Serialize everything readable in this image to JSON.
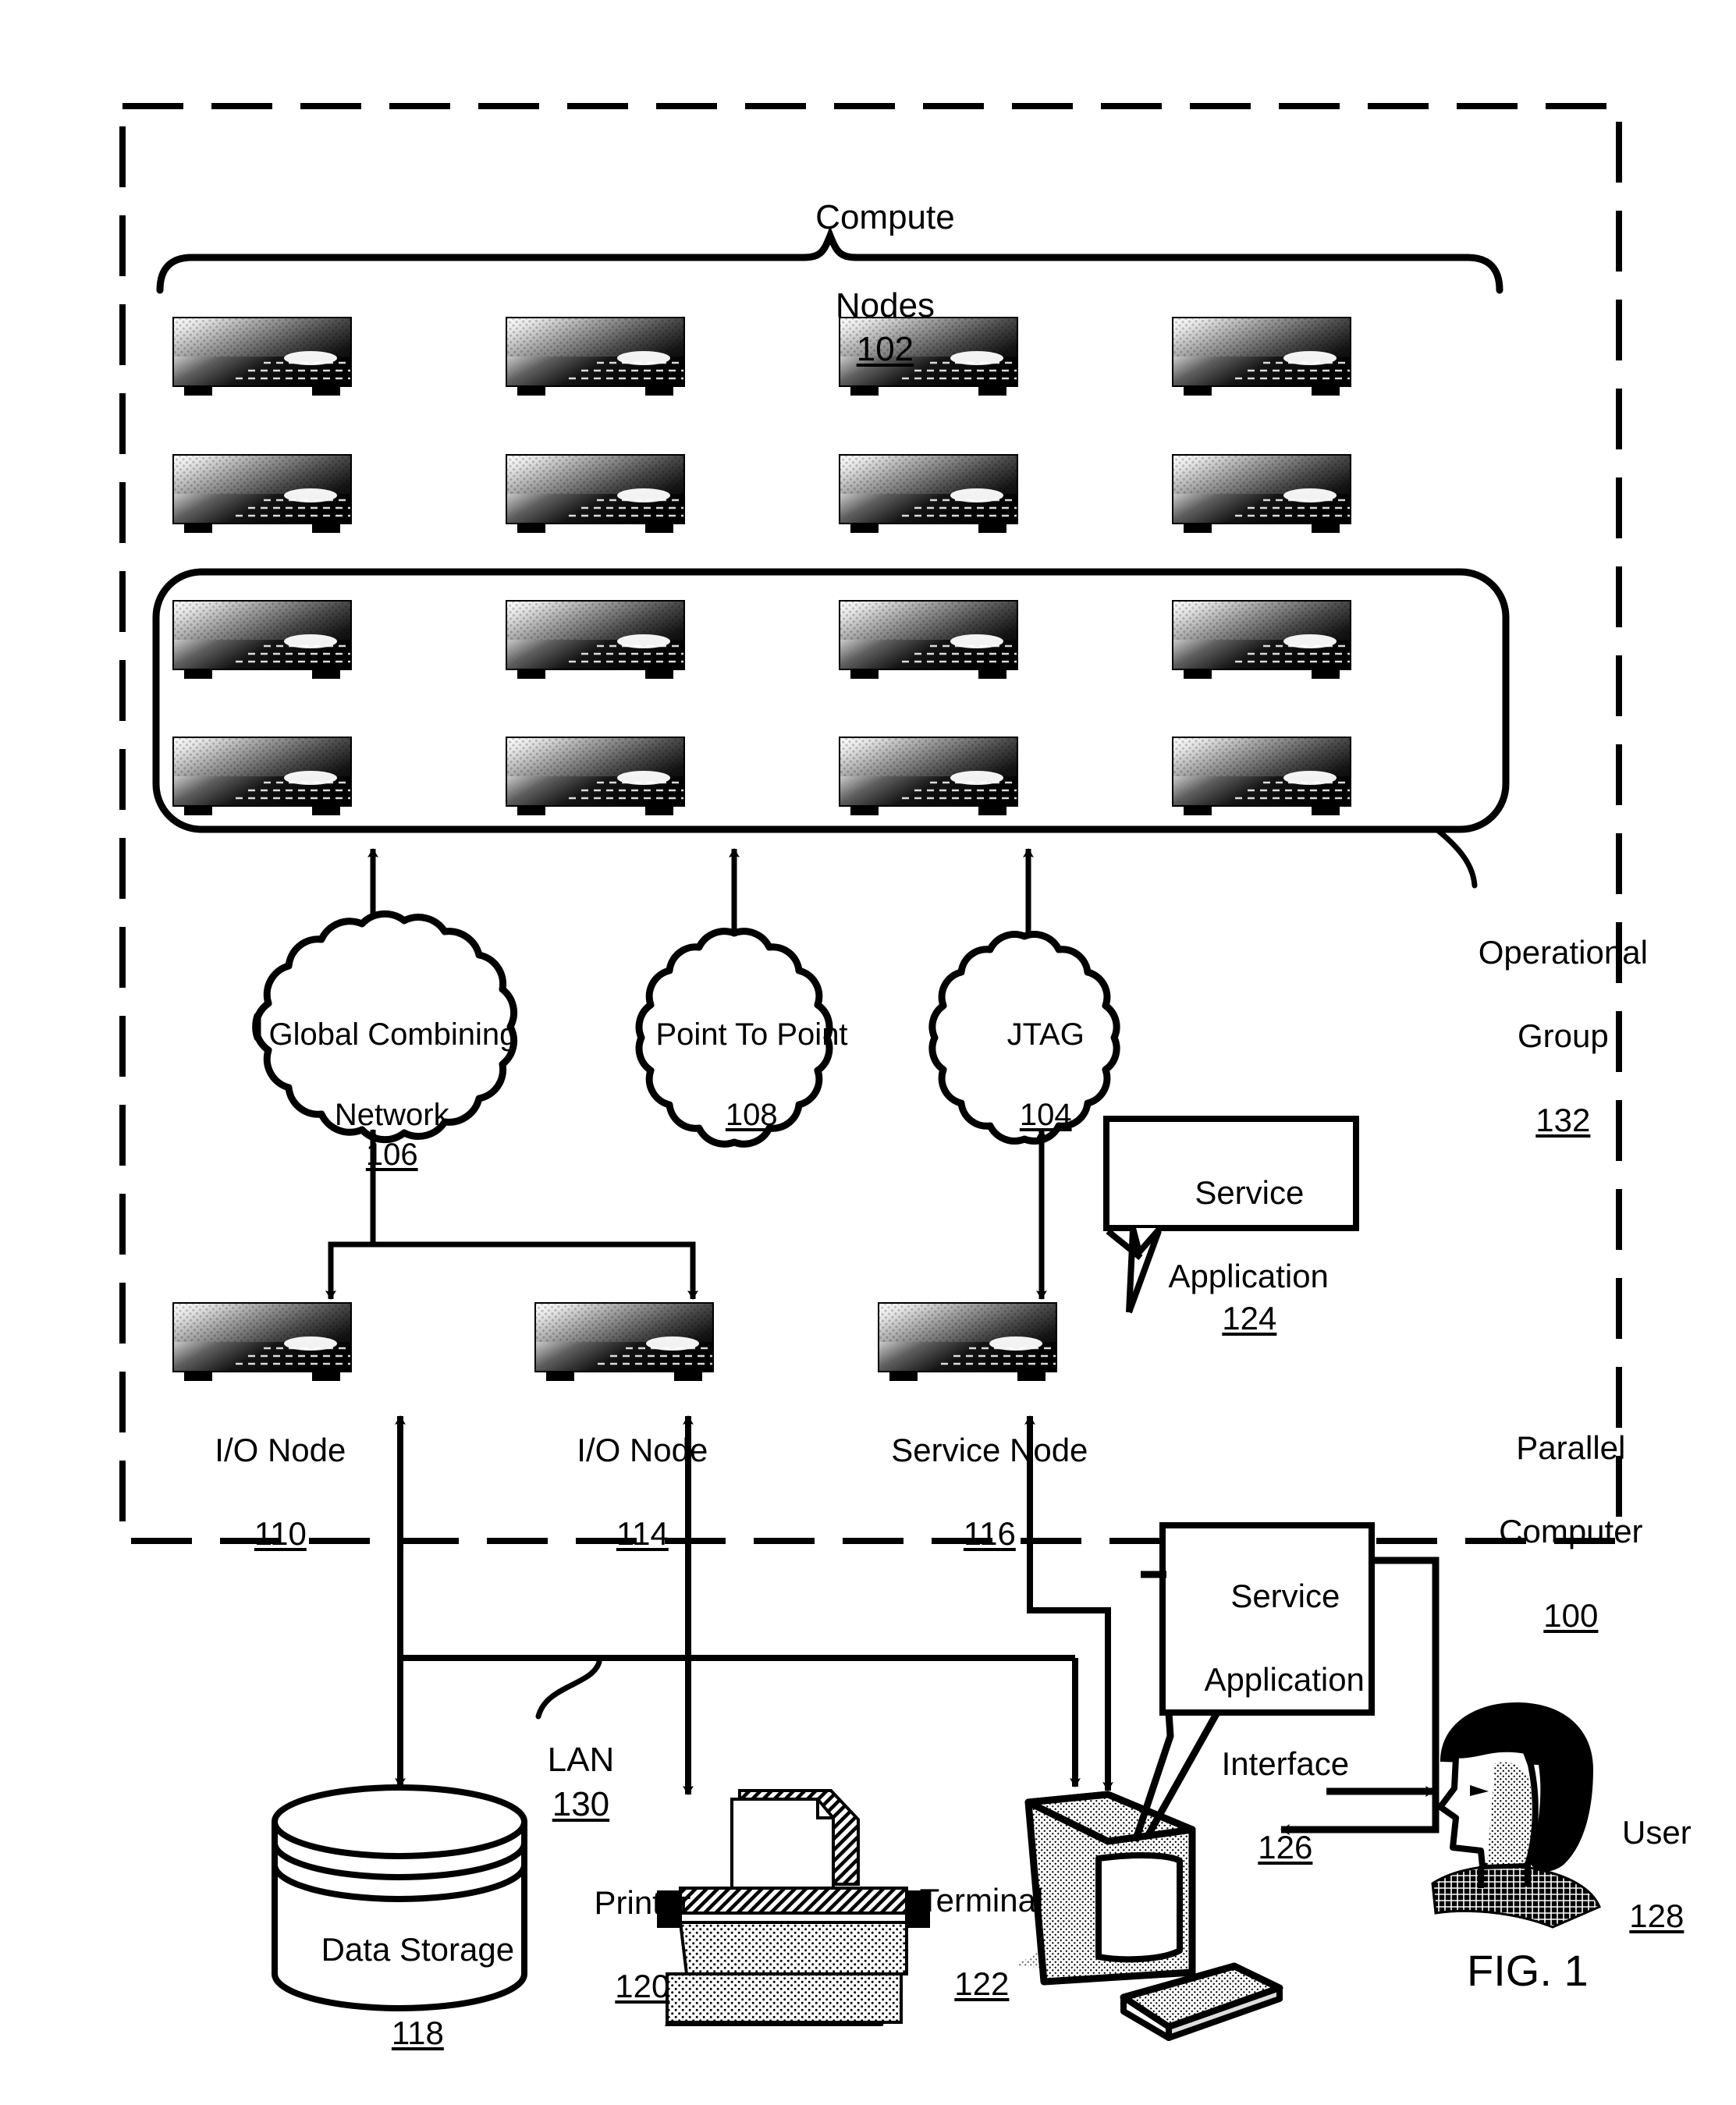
{
  "figure": {
    "label": "FIG. 1",
    "title_line1": "Compute",
    "title_line2": "Nodes",
    "title_ref": "102"
  },
  "boundary": {
    "parallel_computer_line1": "Parallel",
    "parallel_computer_line2": "Computer",
    "parallel_computer_ref": "100"
  },
  "operational_group": {
    "line1": "Operational",
    "line2": "Group",
    "ref": "132"
  },
  "compute_nodes": {
    "rows": 4,
    "cols": 4,
    "count": 16,
    "in_operational_group_rows": [
      3,
      4
    ]
  },
  "networks": [
    {
      "id": "global-combining-network",
      "line1": "Global Combining",
      "line2": "Network",
      "ref": "106"
    },
    {
      "id": "point-to-point",
      "line1": "Point To Point",
      "line2": "",
      "ref": "108"
    },
    {
      "id": "jtag",
      "line1": "JTAG",
      "line2": "",
      "ref": "104"
    }
  ],
  "nodes": [
    {
      "id": "io-node-110",
      "label": "I/O Node",
      "ref": "110"
    },
    {
      "id": "io-node-114",
      "label": "I/O Node",
      "ref": "114"
    },
    {
      "id": "service-node-116",
      "label": "Service Node",
      "ref": "116"
    }
  ],
  "callouts": {
    "service_application": {
      "line1": "Service",
      "line2": "Application",
      "ref": "124"
    },
    "service_application_interface": {
      "line1": "Service",
      "line2": "Application",
      "line3": "Interface",
      "ref": "126"
    }
  },
  "lan": {
    "label": "LAN",
    "ref": "130"
  },
  "peripherals": [
    {
      "id": "data-storage",
      "label": "Data Storage",
      "ref": "118"
    },
    {
      "id": "printer",
      "label": "Printer",
      "ref": "120"
    },
    {
      "id": "terminal",
      "label": "Terminal",
      "ref": "122"
    },
    {
      "id": "user",
      "label": "User",
      "ref": "128"
    }
  ],
  "colors": {
    "ink": "#000000",
    "paper": "#ffffff"
  }
}
